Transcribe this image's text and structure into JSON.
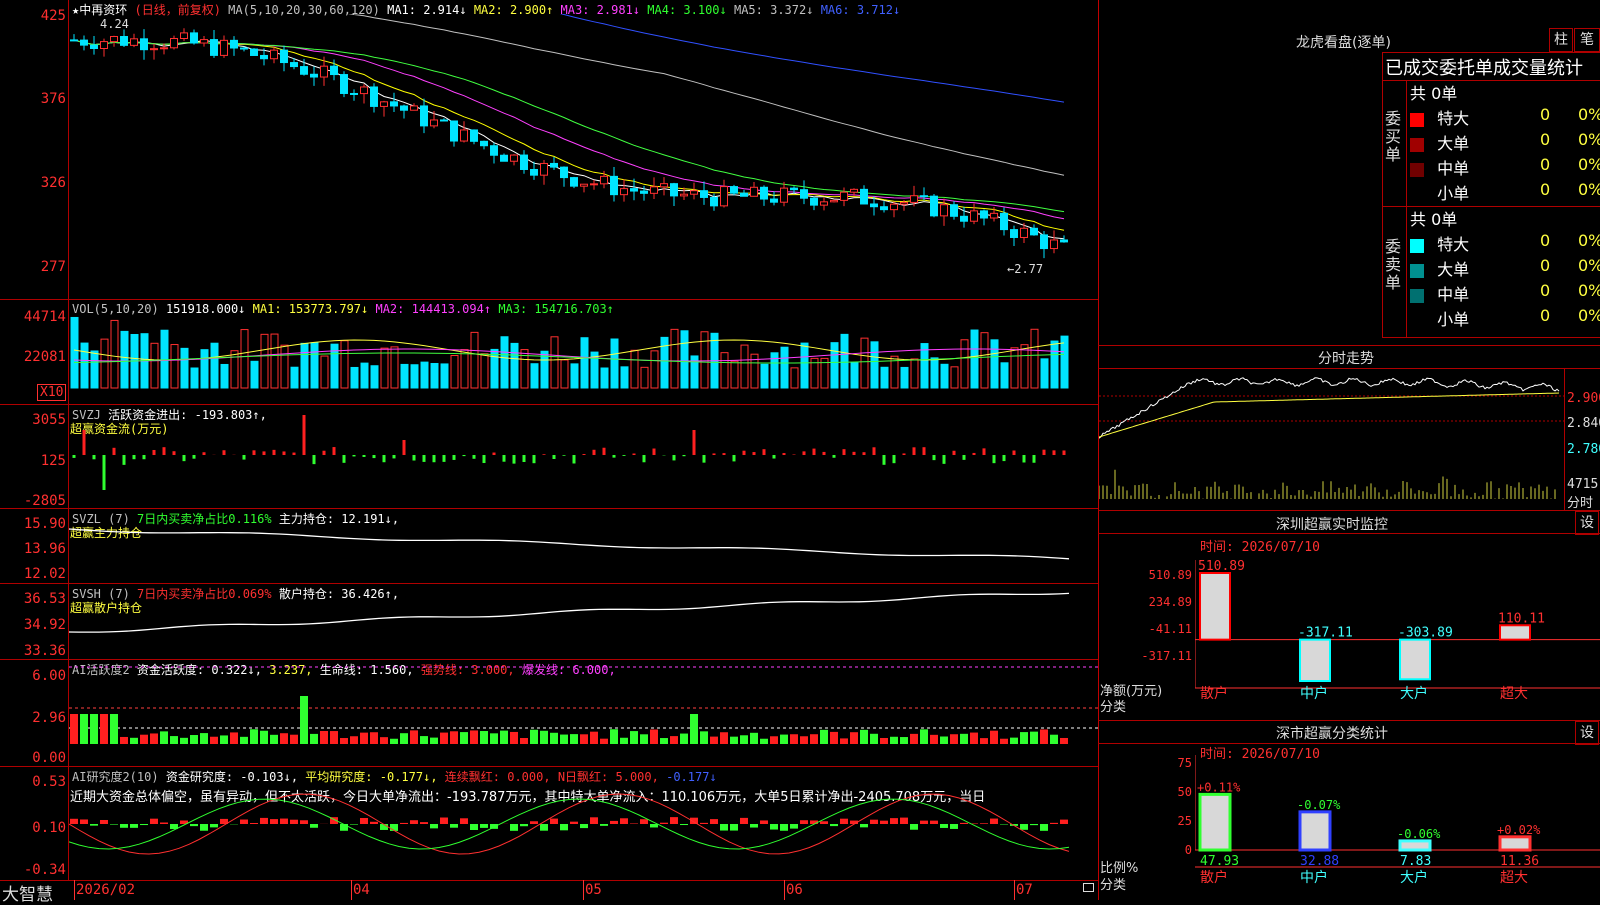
{
  "main_chart": {
    "name": "★中再资环",
    "period": "(日线，前复权)",
    "ma_label": "MA(5,10,20,30,60,120)",
    "ma1": "MA1: 2.914↓",
    "ma2": "MA2: 2.900↑",
    "ma3": "MA3: 2.981↓",
    "ma4": "MA4: 3.100↓",
    "ma5": "MA5: 3.372↓",
    "ma6": "MA6: 3.712↓",
    "high_label": "4.24",
    "low_label": "2.77",
    "y_ticks": [
      "425",
      "376",
      "326",
      "277"
    ]
  },
  "volume_chart": {
    "title": "VOL(5,10,20)",
    "vol": "151918.000↓",
    "ma1": "MA1: 153773.797↓",
    "ma2": "MA2: 144413.094↑",
    "ma3": "MA3: 154716.703↑",
    "y_ticks": [
      "44714",
      "22081"
    ],
    "unit": "X10"
  },
  "svzj": {
    "title": "SVZJ",
    "value": "活跃资金进出: -193.803↑,",
    "subtitle": "超赢资金流(万元)",
    "y_ticks": [
      "3055",
      "125",
      "-2805"
    ]
  },
  "svzl": {
    "title": "SVZL (7)",
    "ratio": "7日内买卖净占比0.116%",
    "main": "主力持仓: 12.191↓,",
    "subtitle": "超赢主力持仓",
    "y_ticks": [
      "15.90",
      "13.96",
      "12.02"
    ]
  },
  "svsh": {
    "title": "SVSH (7)",
    "ratio": "7日内买卖净占比0.069%",
    "retail": "散户持仓: 36.426↑,",
    "subtitle": "超赢散户持仓",
    "y_ticks": [
      "36.53",
      "34.92",
      "33.36"
    ]
  },
  "ai_active": {
    "title": "AI活跃度2",
    "fund": "资金活跃度: 0.322↓,",
    "v2": "3.237,",
    "life": "生命线: 1.560,",
    "strong": "强势线: 3.000,",
    "burst": "爆发线: 6.000,",
    "y_ticks": [
      "6.00",
      "2.96",
      "0.00"
    ]
  },
  "ai_research": {
    "title": "AI研究度2(10)",
    "fund": "资金研究度: -0.103↓,",
    "avg": "平均研究度: -0.177↓,",
    "cont": "连续飘红: 0.000,",
    "n": "N日飘红: 5.000,",
    "last": "-0.177↓",
    "comment": "近期大资金总体偏空，虽有异动，但不太活跃，今日大单净流出：-193.787万元，其中特大单净流入：110.106万元，大单5日累计净出-2405.708万元，当日",
    "y_ticks": [
      "0.53",
      "0.10",
      "-0.34"
    ]
  },
  "bottom_bar": {
    "brand": "大智慧",
    "dates": [
      "2026/02",
      "04",
      "05",
      "06",
      "07"
    ]
  },
  "right_panel": {
    "header": "龙虎看盘(逐单)",
    "tab1": "柱",
    "tab2": "笔",
    "stats_title": "已成交委托单成交量统计",
    "buy_label": "委买单",
    "sell_label": "委卖单",
    "buy_total": "共 0单",
    "sell_total": "共 0单",
    "buy_rows": [
      {
        "label": "特大",
        "count": "0",
        "pct": "0%",
        "color": "#ff0000"
      },
      {
        "label": "大单",
        "count": "0",
        "pct": "0%",
        "color": "#a00000"
      },
      {
        "label": "中单",
        "count": "0",
        "pct": "0%",
        "color": "#700000"
      },
      {
        "label": "小单",
        "count": "0",
        "pct": "0%",
        "color": "#000000"
      }
    ],
    "sell_rows": [
      {
        "label": "特大",
        "count": "0",
        "pct": "0%",
        "color": "#00ffff"
      },
      {
        "label": "大单",
        "count": "0",
        "pct": "0%",
        "color": "#009090"
      },
      {
        "label": "中单",
        "count": "0",
        "pct": "0%",
        "color": "#007070"
      },
      {
        "label": "小单",
        "count": "0",
        "pct": "0%",
        "color": "#000000"
      }
    ],
    "intraday_title": "分时走势",
    "intraday_ticks": [
      "2.900",
      "2.840",
      "2.780",
      "4715",
      "分时"
    ],
    "monitor_title": "深圳超赢实时监控",
    "settings": "设",
    "monitor_time": "时间: 2026/07/10",
    "monitor_y": [
      "510.89",
      "234.89",
      "-41.11",
      "-317.11"
    ],
    "monitor_axis": "净额(万元)",
    "monitor_axis2": "分类",
    "categories": [
      "散户",
      "中户",
      "大户",
      "超大"
    ],
    "monitor_values": [
      510.89,
      -317.11,
      -303.89,
      110.11
    ],
    "monitor_labels": [
      "510.89",
      "-317.11",
      "-303.89",
      "110.11"
    ],
    "class_title": "深市超赢分类统计",
    "class_time": "时间: 2026/07/10",
    "class_y": [
      "75",
      "50",
      "25",
      "0"
    ],
    "class_axis": "比例%",
    "class_axis2": "分类",
    "class_values": [
      47.93,
      32.88,
      7.83,
      11.36
    ],
    "class_top_labels": [
      "+0.11%",
      "-0.07%",
      "-0.06%",
      "+0.02%"
    ],
    "class_bottom_labels": [
      "47.93",
      "32.88",
      "7.83",
      "11.36"
    ]
  },
  "colors": {
    "up": "#ff3030",
    "down": "#00e5ff",
    "grid": "#b00000"
  }
}
